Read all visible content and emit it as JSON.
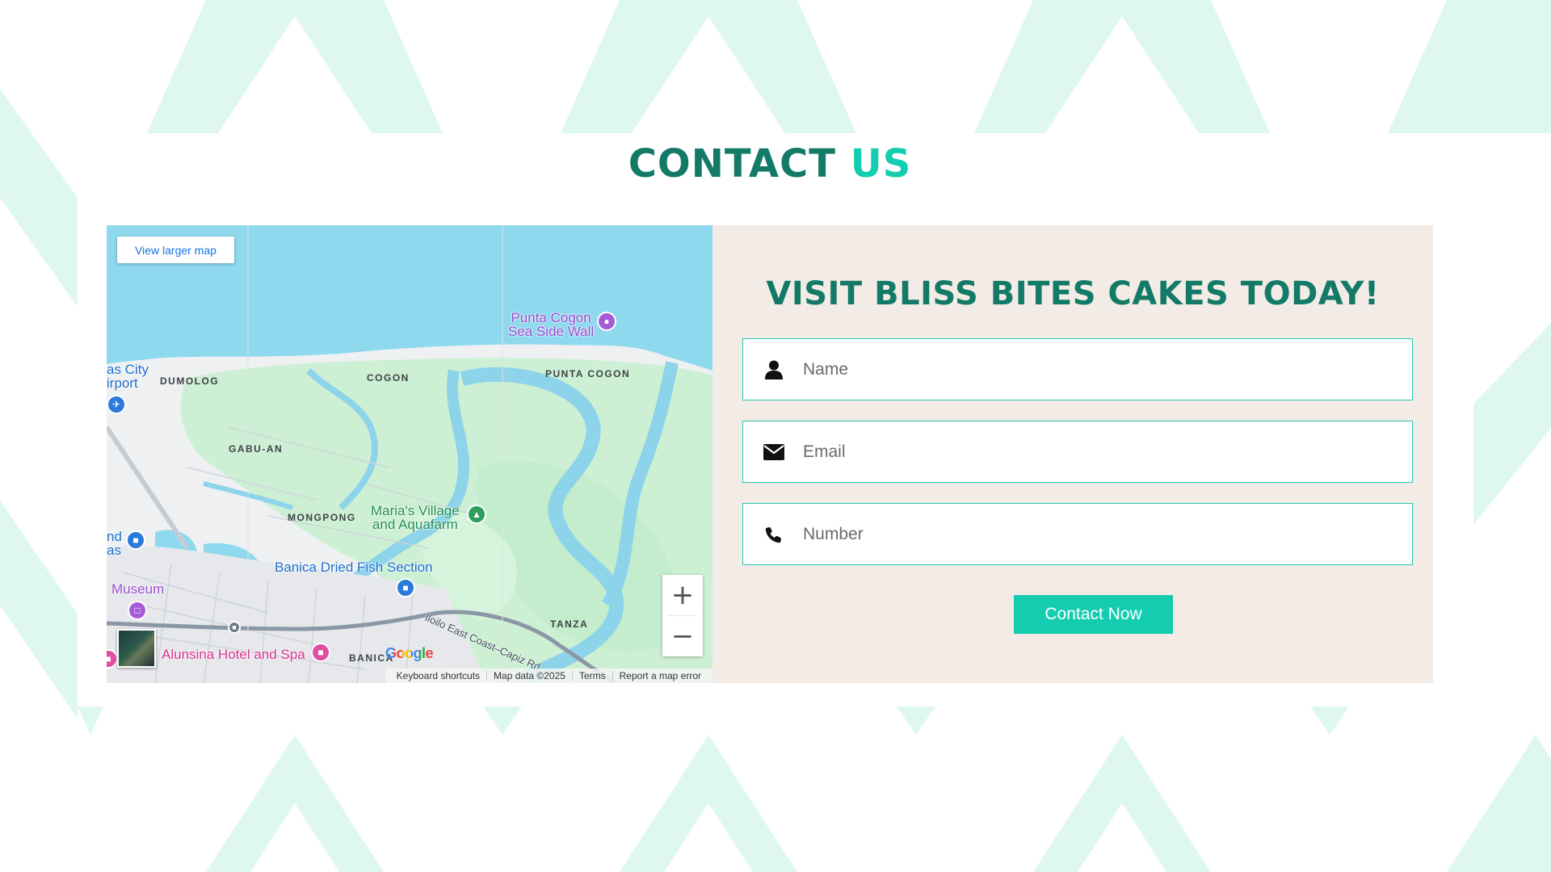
{
  "section": {
    "title_part1": "CONTACT",
    "title_part2": "US"
  },
  "map": {
    "view_larger_label": "View larger map",
    "zoom_in_label": "+",
    "zoom_out_label": "−",
    "google_logo": "Google",
    "attribution": {
      "keyboard_shortcuts": "Keyboard shortcuts",
      "map_data": "Map data ©2025",
      "terms": "Terms",
      "report_error": "Report a map error"
    },
    "labels": {
      "punta_cogon_wall_1": "Punta Cogon",
      "punta_cogon_wall_2": "Sea Side Wall",
      "airport_1": "as City",
      "airport_2": "irport",
      "dumolog": "DUMOLOG",
      "cogon": "COGON",
      "punta_cogon": "PUNTA COGON",
      "gabu_an": "GABU-AN",
      "mongpong": "MONGPONG",
      "marias_1": "Maria's Village",
      "marias_2": "and Aquafarm",
      "nd_as_1": "nd",
      "nd_as_2": "as",
      "banica_fish": "Banica Dried Fish Section",
      "museum": "Museum",
      "alunsina": "Alunsina Hotel and Spa",
      "banica": "BANICA",
      "tanza": "TANZA",
      "road": "Iloilo East Coast–Capiz Rd"
    }
  },
  "form": {
    "heading": "VISIT BLISS BITES CAKES TODAY!",
    "name_placeholder": "Name",
    "email_placeholder": "Email",
    "number_placeholder": "Number",
    "submit_label": "Contact Now"
  },
  "colors": {
    "brand_dark": "#127a66",
    "brand_accent": "#12cdb0",
    "form_bg": "#f3ebe6",
    "pattern": "#dff7f1"
  }
}
